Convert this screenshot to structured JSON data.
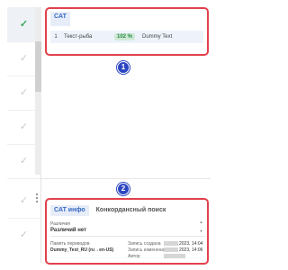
{
  "segments": {
    "rows": [
      {
        "check": "✓",
        "state": "confirmed"
      },
      {
        "check": "✓",
        "state": "draft"
      },
      {
        "check": "✓",
        "state": "draft"
      },
      {
        "check": "✓",
        "state": "draft"
      },
      {
        "check": "✓",
        "state": "draft"
      },
      {
        "check": "✓",
        "state": "draft"
      },
      {
        "check": "✓",
        "state": "draft"
      }
    ]
  },
  "cat": {
    "tab_label": "CAT",
    "match": {
      "index": "1",
      "text": "Текст-рыба",
      "percent": "102 %",
      "source": "Dummy Text"
    }
  },
  "badges": {
    "one": "1",
    "two": "2"
  },
  "info": {
    "tab_cat_info": "CAT инфо",
    "tab_concordance": "Конкордансный поиск",
    "diff_label": "Различия",
    "diff_value": "Различий нет",
    "tm_label": "Память переводов",
    "tm_value": "Dummy_Text_RU (ru→en-US)",
    "created_label": "Запись создана",
    "created_value": "2023, 14:04",
    "modified_label": "Запись изменена",
    "modified_value": "2023, 14:06",
    "author_label": "Автор"
  },
  "colors": {
    "accent": "#3567c4",
    "highlight_border": "#e2414d",
    "badge": "#2d46c0",
    "match_green": "#2a8a48"
  }
}
